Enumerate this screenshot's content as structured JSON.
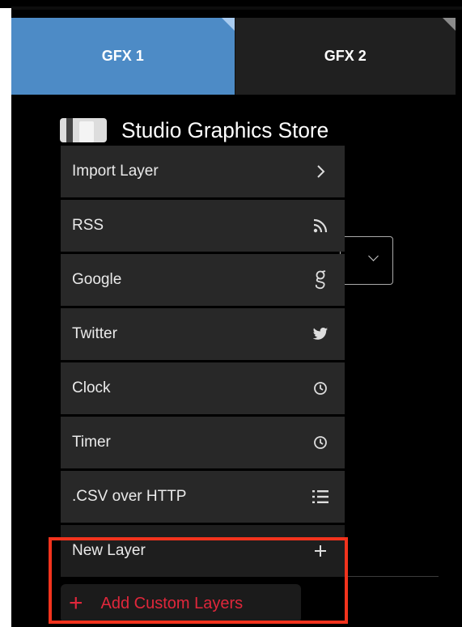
{
  "tabs": [
    {
      "label": "GFX 1",
      "active": true
    },
    {
      "label": "GFX 2",
      "active": false
    }
  ],
  "store": {
    "title": "Studio Graphics Store"
  },
  "menu": {
    "items": [
      {
        "label": "Import Layer",
        "icon": "chevron-right-icon"
      },
      {
        "label": "RSS",
        "icon": "rss-icon"
      },
      {
        "label": "Google",
        "icon": "google-g-icon"
      },
      {
        "label": "Twitter",
        "icon": "twitter-bird-icon"
      },
      {
        "label": "Clock",
        "icon": "clock-icon"
      },
      {
        "label": "Timer",
        "icon": "clock-icon"
      },
      {
        "label": ".CSV over HTTP",
        "icon": "list-icon"
      },
      {
        "label": "New Layer",
        "icon": "plus-icon"
      }
    ]
  },
  "add_custom": {
    "plus": "+",
    "label": "Add Custom Layers"
  },
  "colors": {
    "active_tab": "#4d8bc6",
    "inactive_tab": "#202020",
    "menu_bg": "#282828",
    "highlight": "#f2331d",
    "add_custom_text": "#e0273b"
  }
}
